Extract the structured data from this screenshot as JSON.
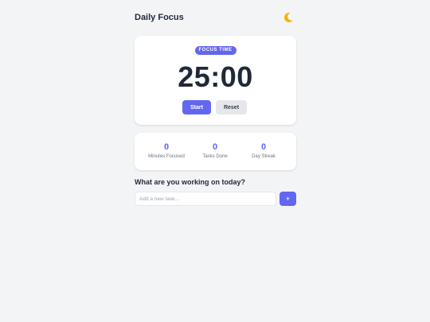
{
  "header": {
    "title": "Daily Focus",
    "theme_icon": "moon-icon"
  },
  "timer": {
    "badge": "FOCUS TIME",
    "display": "25:00",
    "start_label": "Start",
    "reset_label": "Reset"
  },
  "stats": [
    {
      "value": "0",
      "label": "Minutes Focused"
    },
    {
      "value": "0",
      "label": "Tasks Done"
    },
    {
      "value": "0",
      "label": "Day Streak"
    }
  ],
  "tasks": {
    "heading": "What are you working on today?",
    "input_value": "",
    "input_placeholder": "Add a new task...",
    "add_label": "+"
  },
  "colors": {
    "accent": "#6366f1",
    "background": "#f3f4f6",
    "card": "#ffffff",
    "moon": "#f5b301"
  }
}
